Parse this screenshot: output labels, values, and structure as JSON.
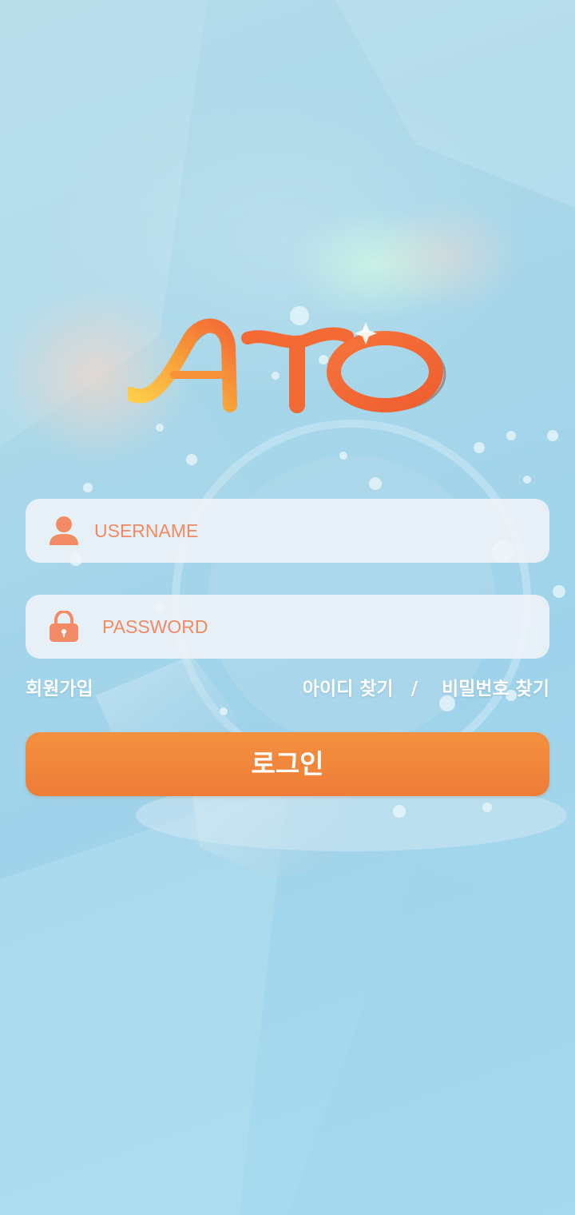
{
  "logo": {
    "text": "ATO"
  },
  "login_form": {
    "username": {
      "placeholder": "USERNAME",
      "value": ""
    },
    "password": {
      "placeholder": "PASSWORD",
      "value": ""
    }
  },
  "links": {
    "signup": "회원가입",
    "find_id": "아이디 찾기",
    "separator": "/",
    "find_password": "비밀번호 찾기"
  },
  "login_button": {
    "label": "로그인"
  },
  "colors": {
    "accent": "#ef7c38",
    "placeholder": "#ef8a62",
    "background": "#a6d6e9"
  }
}
